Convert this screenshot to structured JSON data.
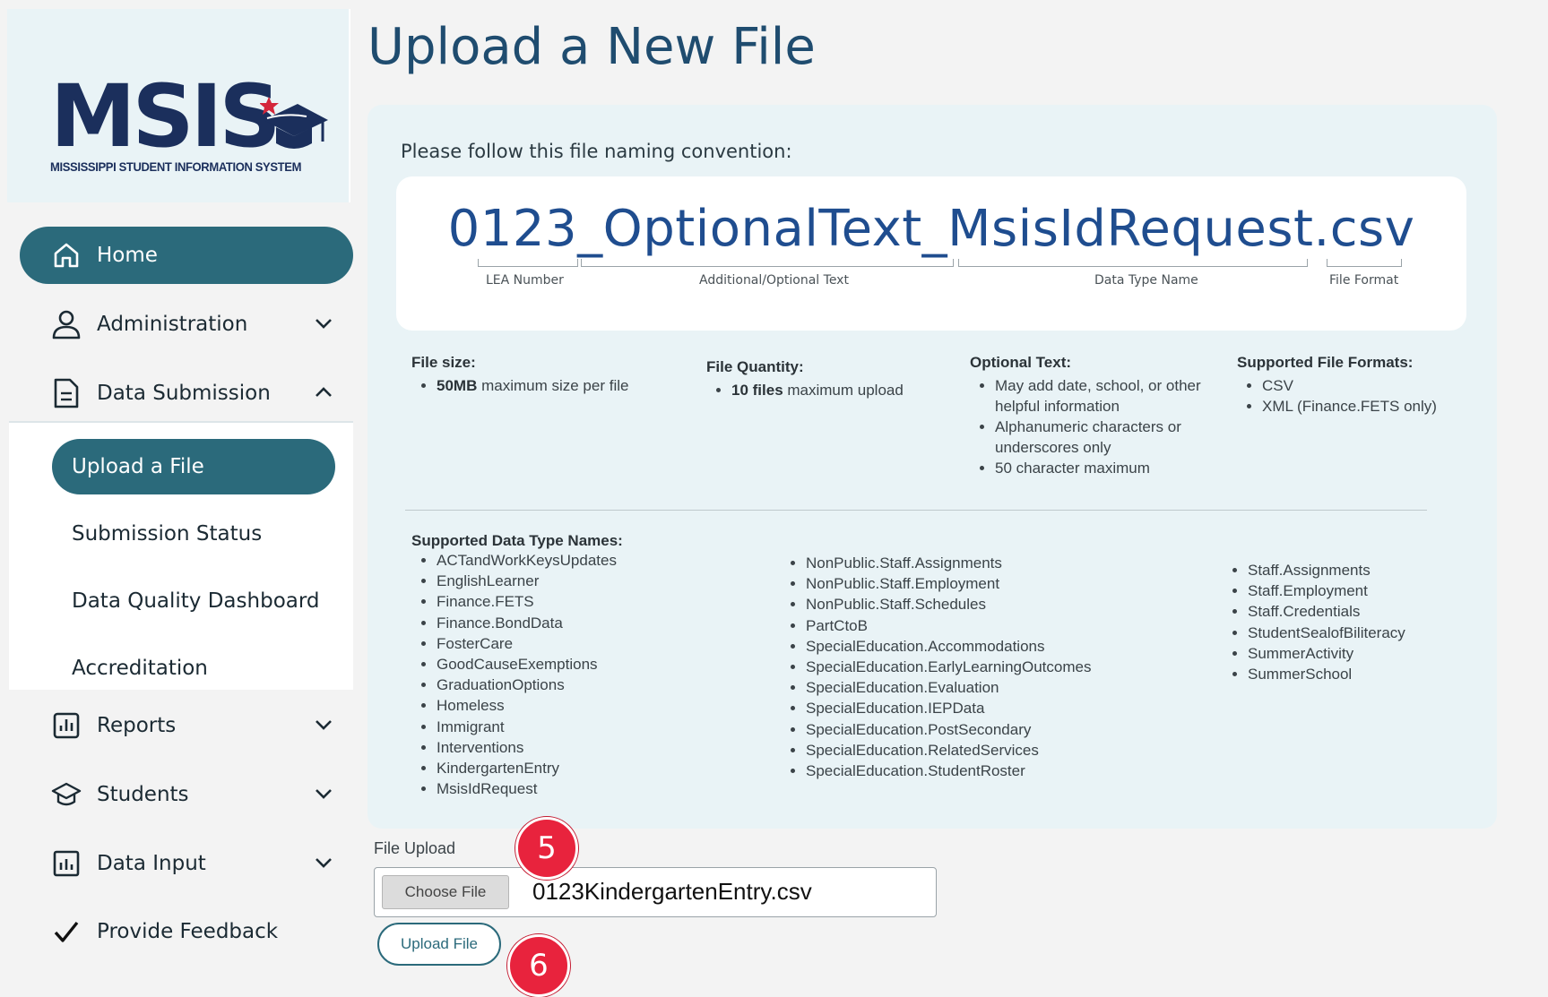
{
  "logo": {
    "text": "MSIS",
    "subtitle": "MISSISSIPPI STUDENT INFORMATION SYSTEM"
  },
  "sidebar": {
    "home": "Home",
    "administration": "Administration",
    "data_submission": "Data Submission",
    "sub_items": [
      "Upload a File",
      "Submission Status",
      "Data Quality Dashboard",
      "Accreditation"
    ],
    "reports": "Reports",
    "students": "Students",
    "data_input": "Data Input",
    "feedback": "Provide Feedback"
  },
  "main": {
    "title": "Upload a New File",
    "convention_label": "Please follow this file naming convention:",
    "filename_example": "0123_OptionalText_MsisIdRequest.csv",
    "segments": [
      "LEA Number",
      "Additional/Optional Text",
      "Data Type Name",
      "File Format"
    ],
    "file_size": {
      "heading": "File size:",
      "bold": "50MB",
      "rest": " maximum size per file"
    },
    "file_quantity": {
      "heading": "File Quantity:",
      "bold": "10 files",
      "rest": " maximum upload"
    },
    "optional_text": {
      "heading": "Optional Text:",
      "items": [
        "May add date, school, or other helpful information",
        "Alphanumeric characters or underscores only",
        "50 character maximum"
      ]
    },
    "formats": {
      "heading": "Supported File Formats:",
      "items": [
        "CSV",
        "XML (Finance.FETS only)"
      ]
    },
    "data_types_heading": "Supported Data Type Names:",
    "data_types_col1": [
      "ACTandWorkKeysUpdates",
      "EnglishLearner",
      "Finance.FETS",
      "Finance.BondData",
      "FosterCare",
      "GoodCauseExemptions",
      "GraduationOptions",
      "Homeless",
      "Immigrant",
      "Interventions",
      "KindergartenEntry",
      "MsisIdRequest"
    ],
    "data_types_col2": [
      "NonPublic.Staff.Assignments",
      "NonPublic.Staff.Employment",
      "NonPublic.Staff.Schedules",
      "PartCtoB",
      "SpecialEducation.Accommodations",
      "SpecialEducation.EarlyLearningOutcomes",
      "SpecialEducation.Evaluation",
      "SpecialEducation.IEPData",
      "SpecialEducation.PostSecondary",
      "SpecialEducation.RelatedServices",
      "SpecialEducation.StudentRoster"
    ],
    "data_types_col3": [
      "Staff.Assignments",
      "Staff.Employment",
      "Staff.Credentials",
      "StudentSealofBiliteracy",
      "SummerActivity",
      "SummerSchool"
    ]
  },
  "upload": {
    "label": "File Upload",
    "choose_label": "Choose File",
    "selected_file": "0123KindergartenEntry.csv",
    "button": "Upload File"
  },
  "badges": [
    "5",
    "6"
  ],
  "colors": {
    "primary": "#2b6a7b",
    "title": "#1f4c6f",
    "panel": "#e9f3f6",
    "badge": "#e8233d"
  }
}
